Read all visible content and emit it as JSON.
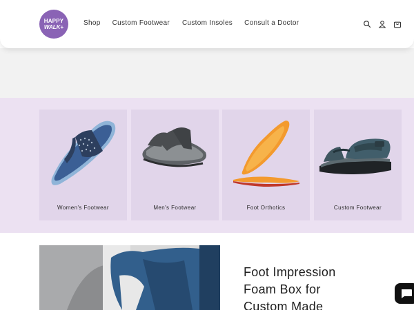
{
  "brand": {
    "logo_line1": "HAPPY",
    "logo_line2": "WALK+",
    "logo_color": "#8a63b5"
  },
  "nav": {
    "items": [
      {
        "label": "Shop"
      },
      {
        "label": "Custom Footwear"
      },
      {
        "label": "Custom Insoles"
      },
      {
        "label": "Consult a Doctor"
      }
    ]
  },
  "header_icons": [
    "search-icon",
    "account-icon",
    "cart-icon"
  ],
  "categories": [
    {
      "label": "Women's Footwear"
    },
    {
      "label": "Men's Footwear"
    },
    {
      "label": "Foot Orthotics"
    },
    {
      "label": "Custom Footwear"
    }
  ],
  "feature": {
    "title_lines": [
      "Foot Impression",
      "Foam Box for",
      "Custom Made"
    ]
  },
  "colors": {
    "lavender_band": "#ece1f2",
    "card_bg": "#e1d5ea",
    "grey_band": "#f2f2f2"
  }
}
